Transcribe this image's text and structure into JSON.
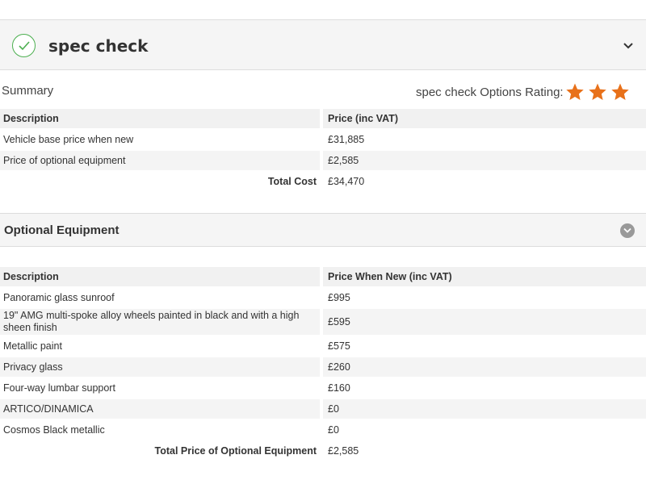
{
  "header": {
    "title": "spec check",
    "status_icon": "check-circle-icon",
    "status_color": "#4caf50",
    "toggle_icon": "chevron-down-icon"
  },
  "summary": {
    "label": "Summary",
    "rating_label": "spec check Options Rating:",
    "rating_stars": 3,
    "rating_color": "#e8711a",
    "columns": [
      "Description",
      "Price (inc VAT)"
    ],
    "rows": [
      {
        "description": "Vehicle base price when new",
        "price": "£31,885"
      },
      {
        "description": "Price of optional equipment",
        "price": "£2,585"
      }
    ],
    "total_label": "Total Cost",
    "total_value": "£34,470"
  },
  "optional": {
    "title": "Optional Equipment",
    "toggle_icon": "chevron-down-circle-icon",
    "columns": [
      "Description",
      "Price When New (inc VAT)"
    ],
    "rows": [
      {
        "description": "Panoramic glass sunroof",
        "price": "£995"
      },
      {
        "description": "19\" AMG multi-spoke alloy wheels painted in black and with a high sheen finish",
        "price": "£595"
      },
      {
        "description": "Metallic paint",
        "price": "£575"
      },
      {
        "description": "Privacy glass",
        "price": "£260"
      },
      {
        "description": "Four-way lumbar support",
        "price": "£160"
      },
      {
        "description": "ARTICO/DINAMICA",
        "price": "£0"
      },
      {
        "description": "Cosmos Black metallic",
        "price": "£0"
      }
    ],
    "total_label": "Total Price of Optional Equipment",
    "total_value": "£2,585"
  }
}
